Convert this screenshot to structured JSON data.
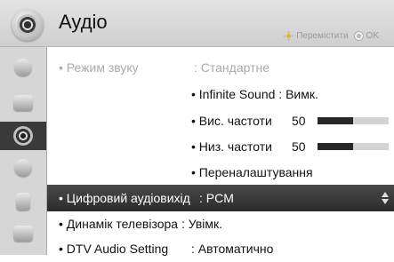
{
  "header": {
    "title": "Аудіо",
    "hint_move": "Перемістити",
    "hint_ok": "OK"
  },
  "sidebar": {
    "items": [
      {
        "icon": "picture-settings-icon"
      },
      {
        "icon": "display-icon"
      },
      {
        "icon": "audio-icon",
        "active": true
      },
      {
        "icon": "clock-icon"
      },
      {
        "icon": "lock-icon"
      },
      {
        "icon": "options-icon"
      }
    ]
  },
  "menu": {
    "sound_mode": {
      "label": "• Режим звуку",
      "value": ": Стандартне"
    },
    "infinite_sound": {
      "label": "• Infinite Sound : Вимк."
    },
    "treble": {
      "label": "• Вис. частоти",
      "value": "50",
      "level": 0.5
    },
    "bass": {
      "label": "• Низ. частоти",
      "value": "50",
      "level": 0.5
    },
    "reset": {
      "label": "• Переналаштування"
    },
    "digital_out": {
      "label": "• Цифровий аудіовихід",
      "value": ": PCM"
    },
    "tv_speaker": {
      "label": "• Динамік телевізора : Увімк."
    },
    "dtv_audio": {
      "label": "• DTV Audio Setting",
      "value": ": Автоматично"
    }
  },
  "colors": {
    "selected_bg": "#333333",
    "bar_fill": "#262626",
    "bar_track": "#d3d3d3",
    "sidebar_bg": "#d6d6d6"
  }
}
